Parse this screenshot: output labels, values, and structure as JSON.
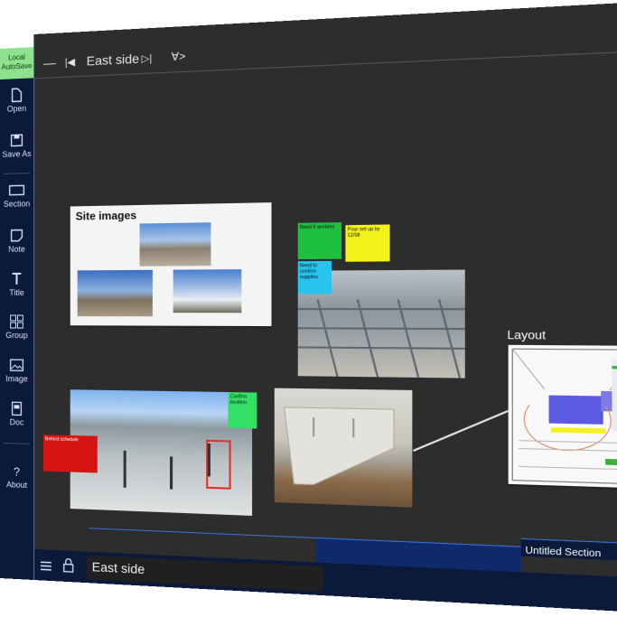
{
  "sidebar": {
    "autosave": "Local AutoSave",
    "items": [
      {
        "label": "Open",
        "icon": "open-file-icon"
      },
      {
        "label": "Save As",
        "icon": "save-icon"
      },
      {
        "label": "Section",
        "icon": "section-icon"
      },
      {
        "label": "Note",
        "icon": "note-icon"
      },
      {
        "label": "Title",
        "icon": "title-icon"
      },
      {
        "label": "Group",
        "icon": "group-icon"
      },
      {
        "label": "Image",
        "icon": "image-icon"
      },
      {
        "label": "Doc",
        "icon": "doc-icon"
      },
      {
        "label": "About",
        "icon": "question-icon"
      }
    ]
  },
  "topbar": {
    "minus": "—",
    "first": "|◀",
    "title": "East side",
    "next": "▷|",
    "filter": "∀>"
  },
  "canvas": {
    "site_images_title": "Site images",
    "sticky_green_top": "Need 5 workers",
    "sticky_yellow_top": "Pour set up by 12/08",
    "sticky_blue": "Need to confirm supplies",
    "sticky_red": "Behind schedule",
    "sticky_green_right": "Confirm location",
    "layout_label": "Layout"
  },
  "window_controls": {
    "search": "⌕",
    "restore": "⧉",
    "close": "✕"
  },
  "bottom": {
    "section_name": "East side",
    "untitled_tab": "Untitled Section"
  },
  "colors": {
    "sidebar_bg": "#0b1a3a",
    "canvas_bg": "#2d2d2d",
    "accent": "#3b6fd8",
    "autosave_bg": "#8ee28e"
  }
}
